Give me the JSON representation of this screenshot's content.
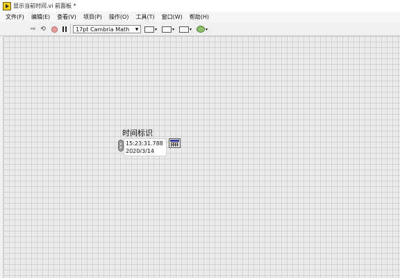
{
  "window": {
    "title": "显示当前时间.vi 前面板 *"
  },
  "menu": [
    "文件(F)",
    "编辑(E)",
    "查看(V)",
    "项目(P)",
    "操作(O)",
    "工具(T)",
    "窗口(W)",
    "帮助(H)"
  ],
  "toolbar": {
    "run_icon": "run-arrow-icon",
    "run_continuously_icon": "run-continuously-icon",
    "abort_icon": "abort-execution-icon",
    "pause_icon": "pause-icon",
    "font_setting": "17pt Cambria Math",
    "tools": [
      "align-objects-icon",
      "distribute-objects-icon",
      "resize-objects-icon",
      "reorder-icon"
    ]
  },
  "timestamp_control": {
    "label": "时间标识",
    "time": "15:23:31.788",
    "date": "2020/3/14",
    "browse_icon": "calendar-icon"
  },
  "colors": {
    "canvas": "#ebebeb",
    "grid": "#d2d2d2",
    "app_icon": "#f6d21a"
  }
}
